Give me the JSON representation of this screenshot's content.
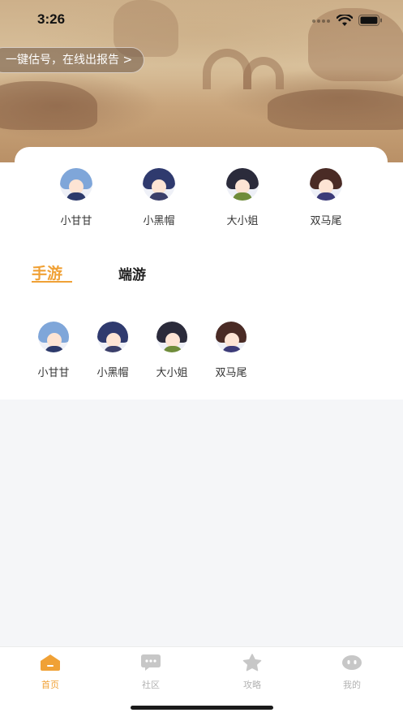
{
  "status_bar": {
    "time": "3:26"
  },
  "banner": {
    "report_text": "一键估号，在线出报告 >"
  },
  "featured_characters": [
    {
      "name": "小甘甘",
      "hair_color": "#7fa6d9",
      "body_color": "#2d3a6b"
    },
    {
      "name": "小黑帽",
      "hair_color": "#2f3a6e",
      "body_color": "#3b3f6a"
    },
    {
      "name": "大小姐",
      "hair_color": "#2b2b3b",
      "body_color": "#6f8c3a"
    },
    {
      "name": "双马尾",
      "hair_color": "#4a2b25",
      "body_color": "#3c3b78"
    }
  ],
  "tabs": {
    "active": "手游",
    "inactive": "端游"
  },
  "mobile_grid": [
    {
      "name": "小甘甘"
    },
    {
      "name": "小黑帽"
    },
    {
      "name": "大小姐"
    },
    {
      "name": "双马尾"
    }
  ],
  "bottom_nav": [
    {
      "label": "首页",
      "icon": "home-icon",
      "active": true
    },
    {
      "label": "社区",
      "icon": "chat-icon",
      "active": false
    },
    {
      "label": "攻略",
      "icon": "star-icon",
      "active": false
    },
    {
      "label": "我的",
      "icon": "profile-icon",
      "active": false
    }
  ],
  "colors": {
    "accent": "#f0a136",
    "inactive": "#c7c7c7"
  }
}
